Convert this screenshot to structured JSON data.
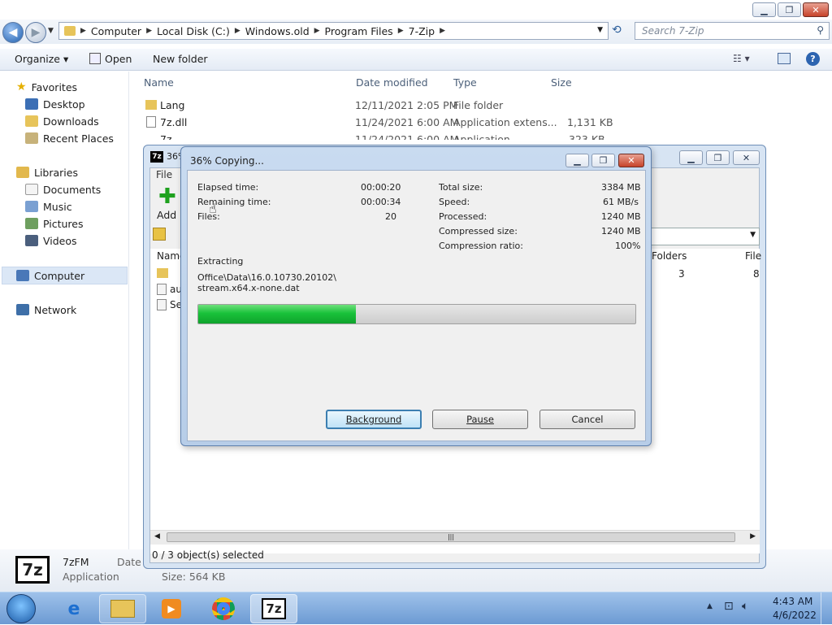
{
  "explorer": {
    "address": [
      "Computer",
      "Local Disk (C:)",
      "Windows.old",
      "Program Files",
      "7-Zip"
    ],
    "search_placeholder": "Search 7-Zip",
    "toolbar": {
      "organize": "Organize ▾",
      "open": "Open",
      "new_folder": "New folder"
    },
    "nav": {
      "favorites": "Favorites",
      "desktop": "Desktop",
      "downloads": "Downloads",
      "recent_places": "Recent Places",
      "libraries": "Libraries",
      "documents": "Documents",
      "music": "Music",
      "pictures": "Pictures",
      "videos": "Videos",
      "computer": "Computer",
      "network": "Network"
    },
    "columns": {
      "name": "Name",
      "date": "Date modified",
      "type": "Type",
      "size": "Size"
    },
    "files": [
      {
        "name": "Lang",
        "date": "12/11/2021 2:05 PM",
        "type": "File folder",
        "size": ""
      },
      {
        "name": "7z.dll",
        "date": "11/24/2021 6:00 AM",
        "type": "Application extens...",
        "size": "1,131 KB"
      },
      {
        "name": "7z",
        "date": "11/24/2021 6:00 AM",
        "type": "Application",
        "size": "323 KB"
      }
    ],
    "status": {
      "icon_text": "7z",
      "name": "7zFM",
      "type": "Application",
      "date_label": "Date m",
      "size": "Size: 564 KB"
    }
  },
  "fm": {
    "title": "36%",
    "menu_file": "File",
    "add_label": "Add",
    "name_header": "Name",
    "folders_header": "Folders",
    "files_header": "File",
    "folders_value": "3",
    "files_value": "8",
    "rows": [
      "au",
      "Set"
    ],
    "status": "0 / 3 object(s) selected"
  },
  "dialog": {
    "title": "36% Copying...",
    "elapsed_label": "Elapsed time:",
    "elapsed_value": "00:00:20",
    "remaining_label": "Remaining time:",
    "remaining_value": "00:00:34",
    "files_label": "Files:",
    "files_value": "20",
    "total_label": "Total size:",
    "total_value": "3384 MB",
    "speed_label": "Speed:",
    "speed_value": "61 MB/s",
    "processed_label": "Processed:",
    "processed_value": "1240 MB",
    "compressed_label": "Compressed size:",
    "compressed_value": "1240 MB",
    "ratio_label": "Compression ratio:",
    "ratio_value": "100%",
    "action": "Extracting",
    "path_line1": "Office\\Data\\16.0.10730.20102\\",
    "path_line2": "stream.x64.x-none.dat",
    "progress": 0.36,
    "buttons": {
      "background": "Background",
      "pause": "Pause",
      "cancel": "Cancel"
    }
  },
  "taskbar": {
    "time": "4:43 AM",
    "date": "4/6/2022",
    "zip_icon_text": "7z"
  },
  "colors": {
    "progress_fill": "#19c23a",
    "accent": "#1f5fae"
  }
}
